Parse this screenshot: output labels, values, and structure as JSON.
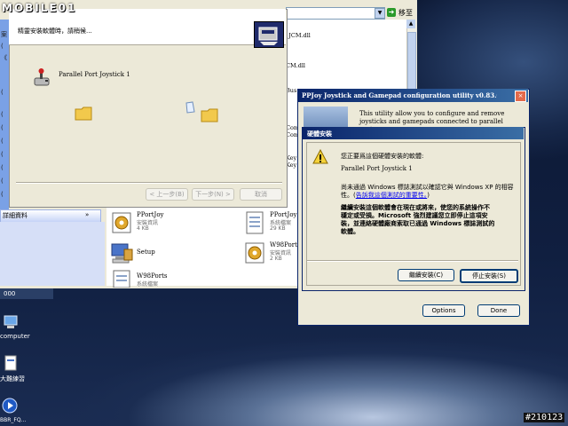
{
  "badges": {
    "logo_text": "MOBILE01",
    "watermark": "#210123"
  },
  "explorer": {
    "go_label": "移至",
    "sidebar_fragments": [
      "案",
      "(",
      "《",
      "(",
      "(",
      "(",
      "(",
      "(",
      "(",
      "(",
      "("
    ],
    "details_header": "詳細資料",
    "details_chevron": "»",
    "file_fragments": [
      "_JCM.dll",
      "CM.dll",
      "Bus",
      "Com",
      "Com",
      "Key",
      "Key"
    ],
    "files": [
      {
        "name": "PPortJoy",
        "type": "安裝資訊",
        "size": "4 KB",
        "icon": "inf-gear-icon"
      },
      {
        "name": "PPortJoy",
        "type": "系統檔案",
        "size": "29 KB",
        "icon": "sys-file-icon"
      },
      {
        "name": "Setup",
        "type": "",
        "size": "",
        "icon": "setup-computer-icon"
      },
      {
        "name": "W98Ports",
        "type": "安裝資訊",
        "size": "2 KB",
        "icon": "inf-gear-icon"
      },
      {
        "name": "W98Ports",
        "type": "系統檔案",
        "size": "",
        "icon": "sys-file-icon"
      }
    ]
  },
  "wizard": {
    "header_text": "精靈安裝軟體時，請稍候...",
    "device_name": "Parallel Port Joystick 1",
    "back_button": "< 上一步(B)",
    "next_button": "下一步(N) >",
    "cancel_button": "取消"
  },
  "ppjoy": {
    "title": "PPJoy Joystick and Gamepad configuration utility  v0.83.0.0...",
    "close_button": "×",
    "description": "This utility allow you to configure and remove joysticks and gamepads connected to parallel ports",
    "options_button": "Options",
    "done_button": "Done"
  },
  "warning": {
    "title": "硬體安裝",
    "line1": "您正要爲這個硬體安裝的軟體:",
    "device": "Parallel Port Joystick 1",
    "line2": "尚未通過 Windows 標誌測試以確認它與 Windows XP 的相容",
    "line2b": "性。(",
    "link": "告訴我這個測試的重要性。",
    "line2c": ")",
    "bold_lines": [
      "繼續安裝這個軟體會在現在或將來，使您的系統操作不",
      "穩定或受損。Microsoft 強烈建議您立即停止這項安",
      "裝，並連絡硬體廠商索取已通過 Windows 標誌測試的",
      "軟體。"
    ],
    "continue_button": "繼續安裝(C)",
    "stop_button": "停止安裝(S)"
  },
  "desktop": {
    "taskbar_fragment": "000",
    "icons": [
      {
        "label": "computer"
      },
      {
        "label": "大難練習"
      },
      {
        "label": "BBR_FQ..."
      }
    ]
  }
}
